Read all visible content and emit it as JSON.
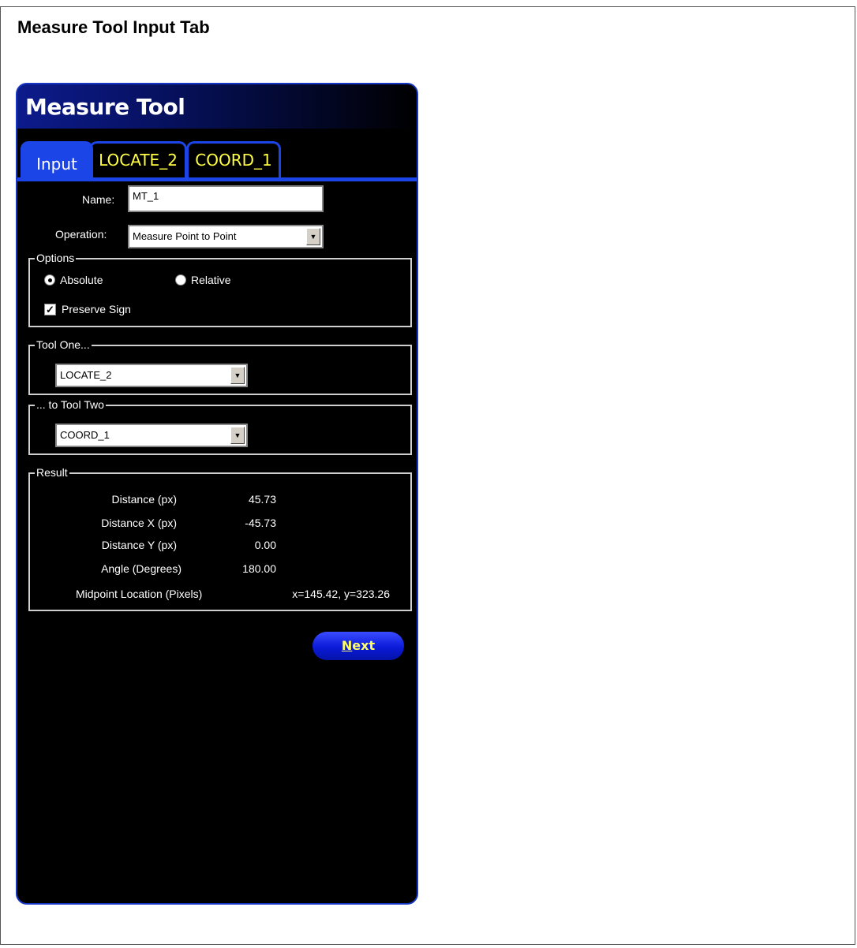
{
  "page": {
    "heading": "Measure Tool Input Tab"
  },
  "panel": {
    "title": "Measure Tool",
    "tabs": [
      {
        "label": "Input",
        "active": true
      },
      {
        "label": "LOCATE_2",
        "active": false
      },
      {
        "label": "COORD_1",
        "active": false
      }
    ],
    "name_label": "Name:",
    "name_value": "MT_1",
    "operation_label": "Operation:",
    "operation_value": "Measure Point to Point",
    "options": {
      "legend": "Options",
      "absolute_label": "Absolute",
      "absolute_selected": true,
      "relative_label": "Relative",
      "relative_selected": false,
      "preserve_sign_label": "Preserve Sign",
      "preserve_sign_checked": true
    },
    "tool_one": {
      "legend": "Tool One...",
      "value": "LOCATE_2"
    },
    "tool_two": {
      "legend": "... to Tool Two",
      "value": "COORD_1"
    },
    "result": {
      "legend": "Result",
      "rows": [
        {
          "label": "Distance   (px)",
          "value": "45.73"
        },
        {
          "label": "Distance X   (px)",
          "value": "-45.73"
        },
        {
          "label": "Distance Y   (px)",
          "value": "0.00"
        },
        {
          "label": "Angle (Degrees)",
          "value": "180.00"
        }
      ],
      "midpoint_label": "Midpoint Location (Pixels)",
      "midpoint_value": "x=145.42, y=323.26"
    },
    "next_label_first": "N",
    "next_label_rest": "ext"
  },
  "colors": {
    "panel_background": "#000000",
    "accent_blue": "#1c45e8",
    "tab_text": "#ffff44",
    "button_text": "#ffff66"
  }
}
